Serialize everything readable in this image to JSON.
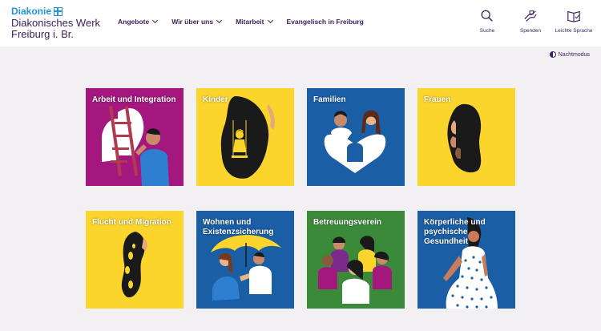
{
  "brand": {
    "name": "Diakonie",
    "subline_1": "Diakonisches Werk",
    "subline_2": "Freiburg i. Br."
  },
  "nav": [
    {
      "label": "Angebote",
      "has_dropdown": true
    },
    {
      "label": "Wir über uns",
      "has_dropdown": true
    },
    {
      "label": "Mitarbeit",
      "has_dropdown": true
    },
    {
      "label": "Evangelisch in Freiburg",
      "has_dropdown": false
    }
  ],
  "tools": [
    {
      "label": "Suche",
      "icon": "search-icon"
    },
    {
      "label": "Spenden",
      "icon": "donate-icon"
    },
    {
      "label": "Leichte Sprache",
      "icon": "easy-language-icon"
    }
  ],
  "nightmode": {
    "label": "Nachtmodus",
    "icon": "contrast-icon"
  },
  "colors": {
    "brand_blue": "#1e97d4",
    "text": "#3b1f5c",
    "magenta": "#a4177f",
    "yellow": "#fbd52b",
    "blue": "#1a5ea5",
    "green": "#3a8a3a"
  },
  "tiles": [
    {
      "label": "Arbeit und Integration",
      "color": "#a4177f"
    },
    {
      "label": "Kinder",
      "color": "#fbd52b"
    },
    {
      "label": "Familien",
      "color": "#1a5ea5"
    },
    {
      "label": "Frauen",
      "color": "#fbd52b"
    },
    {
      "label": "Flucht und Migration",
      "color": "#fbd52b"
    },
    {
      "label": "Wohnen und Existenzsicherung",
      "color": "#1a5ea5"
    },
    {
      "label": "Betreuungsverein",
      "color": "#3a8a3a"
    },
    {
      "label": "Körperliche und psychische Gesundheit",
      "color": "#1a5ea5"
    }
  ]
}
